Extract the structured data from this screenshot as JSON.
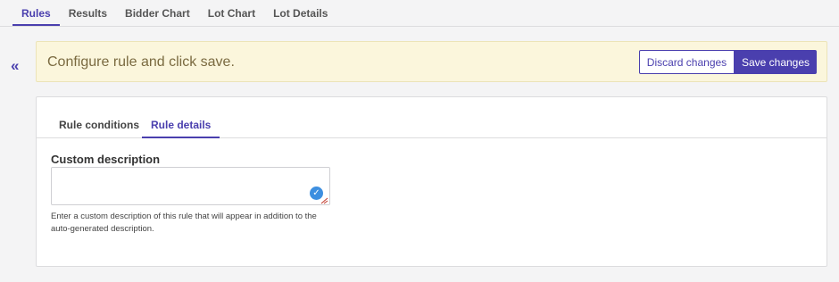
{
  "top_tabs": [
    {
      "label": "Rules",
      "active": true
    },
    {
      "label": "Results",
      "active": false
    },
    {
      "label": "Bidder Chart",
      "active": false
    },
    {
      "label": "Lot Chart",
      "active": false
    },
    {
      "label": "Lot Details",
      "active": false
    }
  ],
  "collapse_icon": "double-chevron-left-icon",
  "banner": {
    "message": "Configure rule and click save.",
    "discard_label": "Discard changes",
    "save_label": "Save changes"
  },
  "panel": {
    "tabs": [
      {
        "label": "Rule conditions",
        "active": false
      },
      {
        "label": "Rule details",
        "active": true
      }
    ],
    "field_label": "Custom description",
    "field_value": "",
    "field_help": "Enter a custom description of this rule that will appear in addition to the auto-generated description."
  },
  "colors": {
    "accent": "#4a3fae",
    "banner_bg": "#fbf6dc",
    "check_icon": "#3d8fe0"
  }
}
